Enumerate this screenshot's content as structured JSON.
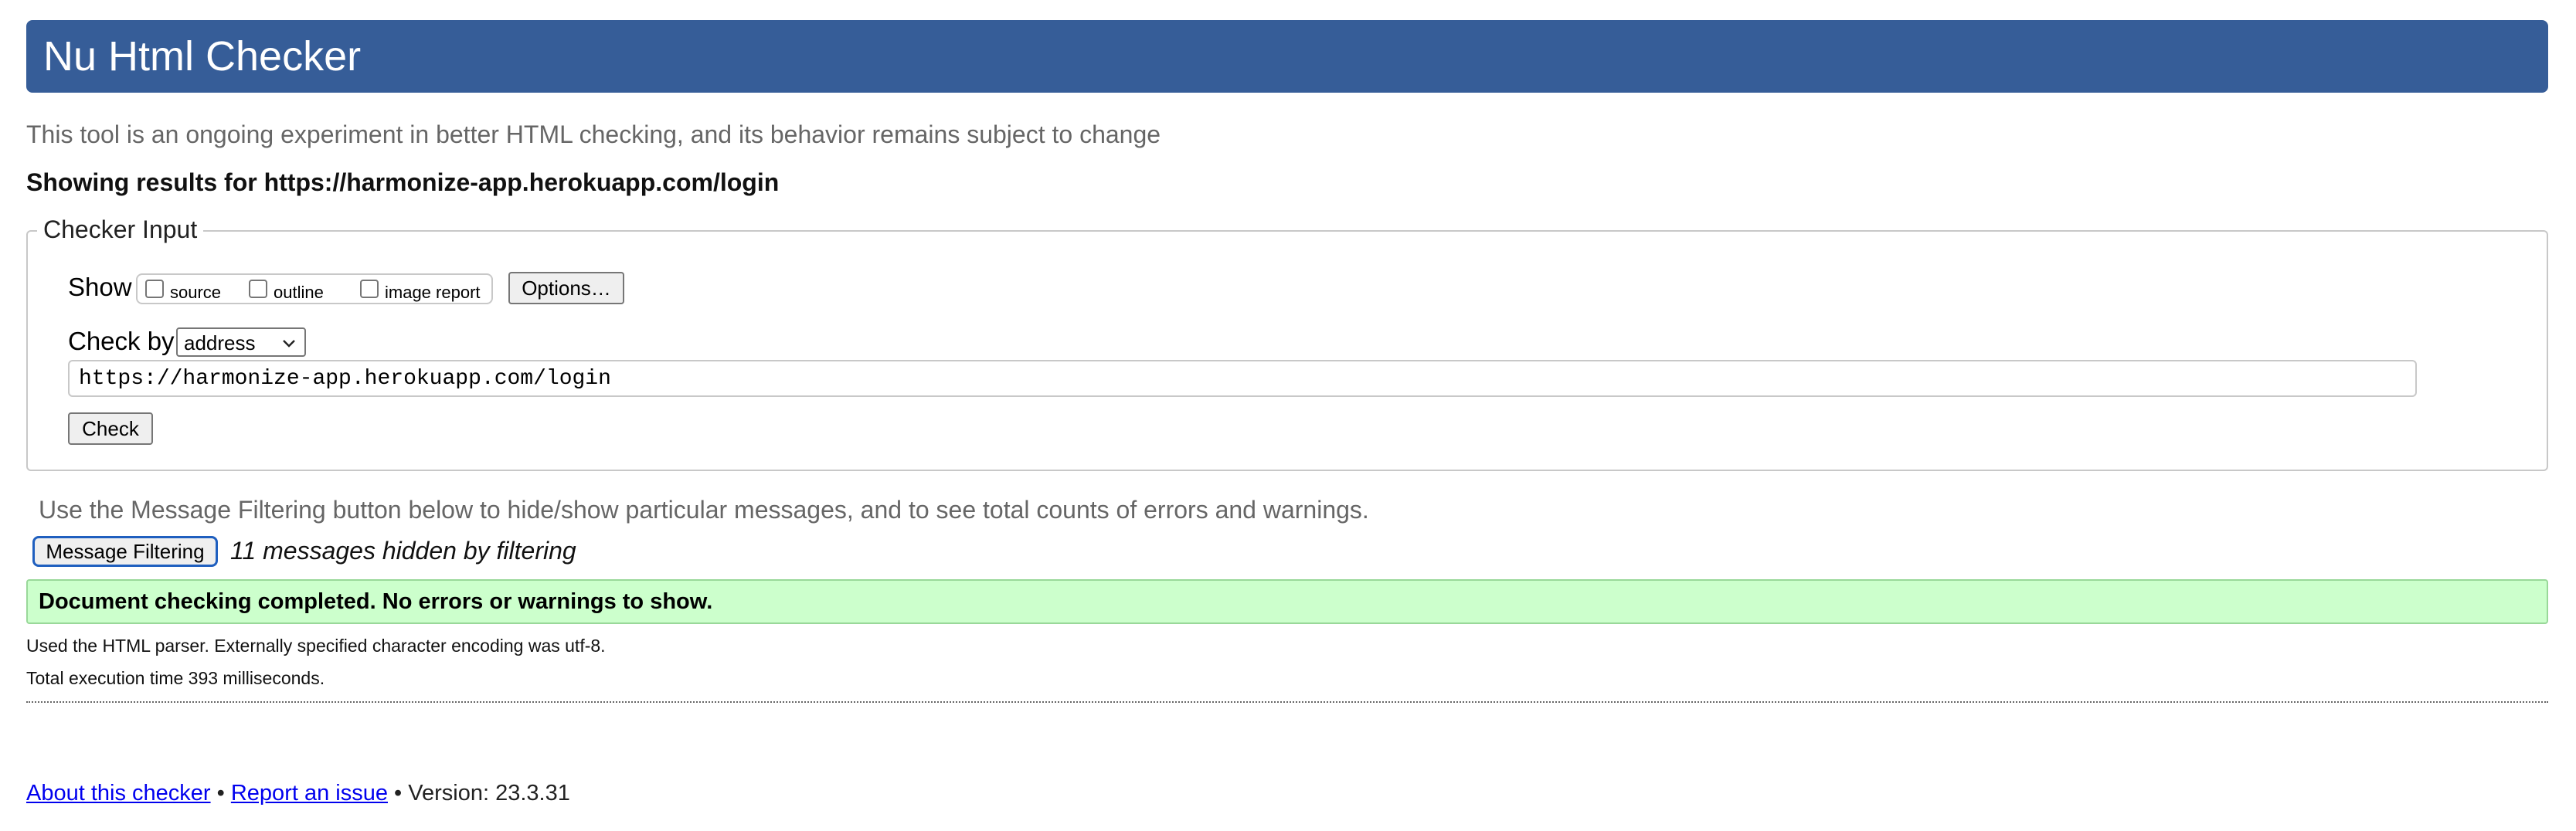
{
  "header": {
    "title": "Nu Html Checker",
    "background_color": "#365d98"
  },
  "subtitle": "This tool is an ongoing experiment in better HTML checking, and its behavior remains subject to change",
  "showing_results": "Showing results for https://harmonize-app.herokuapp.com/login",
  "checker_input": {
    "legend": "Checker Input",
    "show_label": "Show",
    "options": [
      {
        "label": "source",
        "checked": false
      },
      {
        "label": "outline",
        "checked": false
      },
      {
        "label": "image report",
        "checked": false
      }
    ],
    "options_button": "Options…",
    "check_by_label": "Check by",
    "check_by_value": "address",
    "url_value": "https://harmonize-app.herokuapp.com/login",
    "check_button": "Check"
  },
  "filtering": {
    "hint": "Use the Message Filtering button below to hide/show particular messages, and to see total counts of errors and warnings.",
    "button_label": "Message Filtering",
    "hidden_count_text": "11 messages hidden by filtering"
  },
  "result": {
    "message": "Document checking completed. No errors or warnings to show.",
    "background_color": "#ccffcc"
  },
  "notes": {
    "parser": "Used the HTML parser. Externally specified character encoding was utf-8.",
    "execution_time": "Total execution time 393 milliseconds."
  },
  "footer": {
    "about_link": "About this checker",
    "separator": "•",
    "report_link": "Report an issue",
    "version": "Version: 23.3.31"
  }
}
